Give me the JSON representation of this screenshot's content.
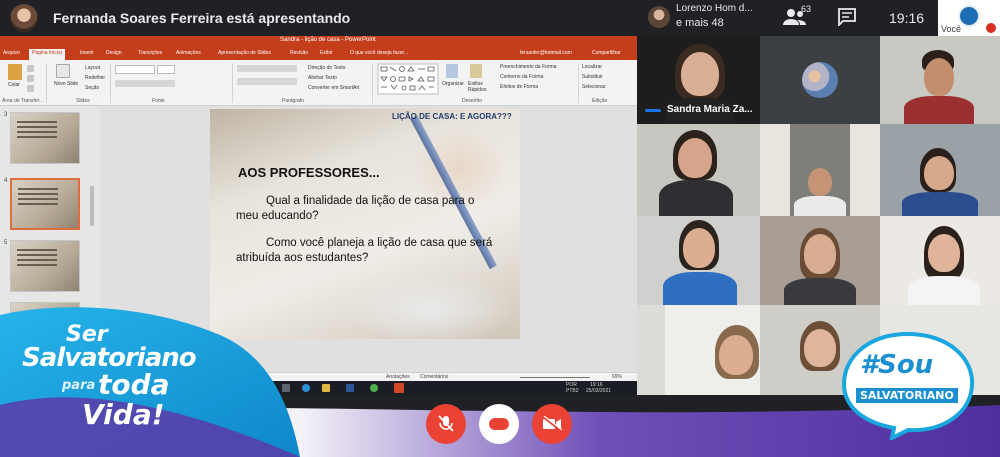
{
  "topbar": {
    "presenter_text": "Fernanda Soares Ferreira está apresentando",
    "top_participant_name": "Lorenzo Hom d...",
    "more_participants": "e mais 48",
    "participant_count": "63",
    "time": "19:16",
    "self_label": "Você"
  },
  "ppt": {
    "title": "Sandra - lição de casa - PowerPoint",
    "user": "fersaofer@hotmail.com",
    "tabs": [
      "Arquivo",
      "Página Inicial",
      "Inserir",
      "Design",
      "Transições",
      "Animações",
      "Apresentação de Slides",
      "Revisão",
      "Exibir",
      "O que você deseja fazer...",
      "Compartilhar"
    ],
    "ribbon_groups": [
      "Área de Transfer...",
      "Slides",
      "Fonte",
      "Parágrafo",
      "Desenho",
      "Edição"
    ],
    "ribbon_items": {
      "paste": "Colar",
      "new_slide": "Novo Slide",
      "layout": "Layout",
      "reset": "Redefinir",
      "section": "Seção",
      "text_direction": "Direção do Texto",
      "align_text": "Alinhar Texto",
      "smartart": "Converter em SmartArt",
      "arrange": "Organizar",
      "quick_styles": "Estilos Rápidos",
      "fill": "Preenchimento da Forma",
      "outline": "Contorno da Forma",
      "effects": "Efeitos de Forma",
      "find": "Localizar",
      "replace": "Substituir",
      "select": "Selecionar"
    },
    "thumb_numbers": [
      "3",
      "4",
      "5"
    ],
    "slide": {
      "header": "LIÇÃO DE CASA: E AGORA???",
      "subtitle": "AOS PROFESSORES...",
      "question1": "Qual a finalidade da lição de casa para o meu educando?",
      "question2": "Como você planeja a lição de casa que será atribuída aos estudantes?"
    },
    "status": {
      "notes": "Anotações",
      "comments": "Comentários",
      "zoom": "69%"
    },
    "taskbar": {
      "lang": "POR",
      "layout": "PTB2",
      "time": "19:16",
      "date": "25/03/2021"
    }
  },
  "tiles": {
    "speaker_name": "Sandra Maria Za..."
  },
  "branding": {
    "left_line1": "Ser",
    "left_line2": "Salvatoriano",
    "left_line3_small": "para",
    "left_line3": "toda",
    "left_line4": "Vida!",
    "right_line1": "#Sou",
    "right_line2": "SALVATORIANO"
  },
  "colors": {
    "ppt_red": "#c43e1c",
    "hangup": "#ea4335",
    "meet_dark": "#202124",
    "brand_blue": "#1aa6df",
    "brand_purple": "#5b3ba8"
  }
}
